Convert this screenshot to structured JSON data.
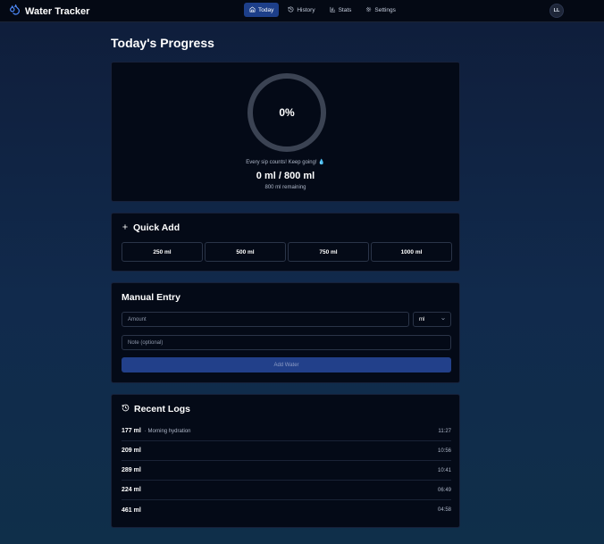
{
  "app": {
    "title": "Water Tracker",
    "logo_icon": "droplets-icon",
    "user_initials": "LL"
  },
  "nav": {
    "tabs": [
      {
        "label": "Today",
        "icon": "home-icon",
        "active": true
      },
      {
        "label": "History",
        "icon": "history-icon",
        "active": false
      },
      {
        "label": "Stats",
        "icon": "bar-chart-icon",
        "active": false
      },
      {
        "label": "Settings",
        "icon": "gear-icon",
        "active": false
      }
    ]
  },
  "page": {
    "title": "Today's Progress"
  },
  "progress": {
    "percent_label": "0%",
    "percent": 0,
    "motivation": "Every sip counts! Keep going! 💧",
    "total": "0 ml / 800 ml",
    "remaining": "800 ml remaining"
  },
  "quick_add": {
    "heading": "Quick Add",
    "icon": "plus-icon",
    "buttons": [
      "250 ml",
      "500 ml",
      "750 ml",
      "1000 ml"
    ]
  },
  "manual_entry": {
    "heading": "Manual Entry",
    "amount_placeholder": "Amount",
    "unit_selected": "ml",
    "note_placeholder": "Note (optional)",
    "submit_label": "Add Water"
  },
  "recent_logs": {
    "heading": "Recent Logs",
    "icon": "history-icon",
    "items": [
      {
        "amount": "177 ml",
        "note": "· Morning hydration",
        "time": "11:27"
      },
      {
        "amount": "209 ml",
        "note": "",
        "time": "10:56"
      },
      {
        "amount": "289 ml",
        "note": "",
        "time": "10:41"
      },
      {
        "amount": "224 ml",
        "note": "",
        "time": "06:49"
      },
      {
        "amount": "461 ml",
        "note": "",
        "time": "04:58"
      }
    ]
  },
  "colors": {
    "accent": "#1d3f8a",
    "card": "#040a17",
    "ring_track": "#3b4353"
  }
}
